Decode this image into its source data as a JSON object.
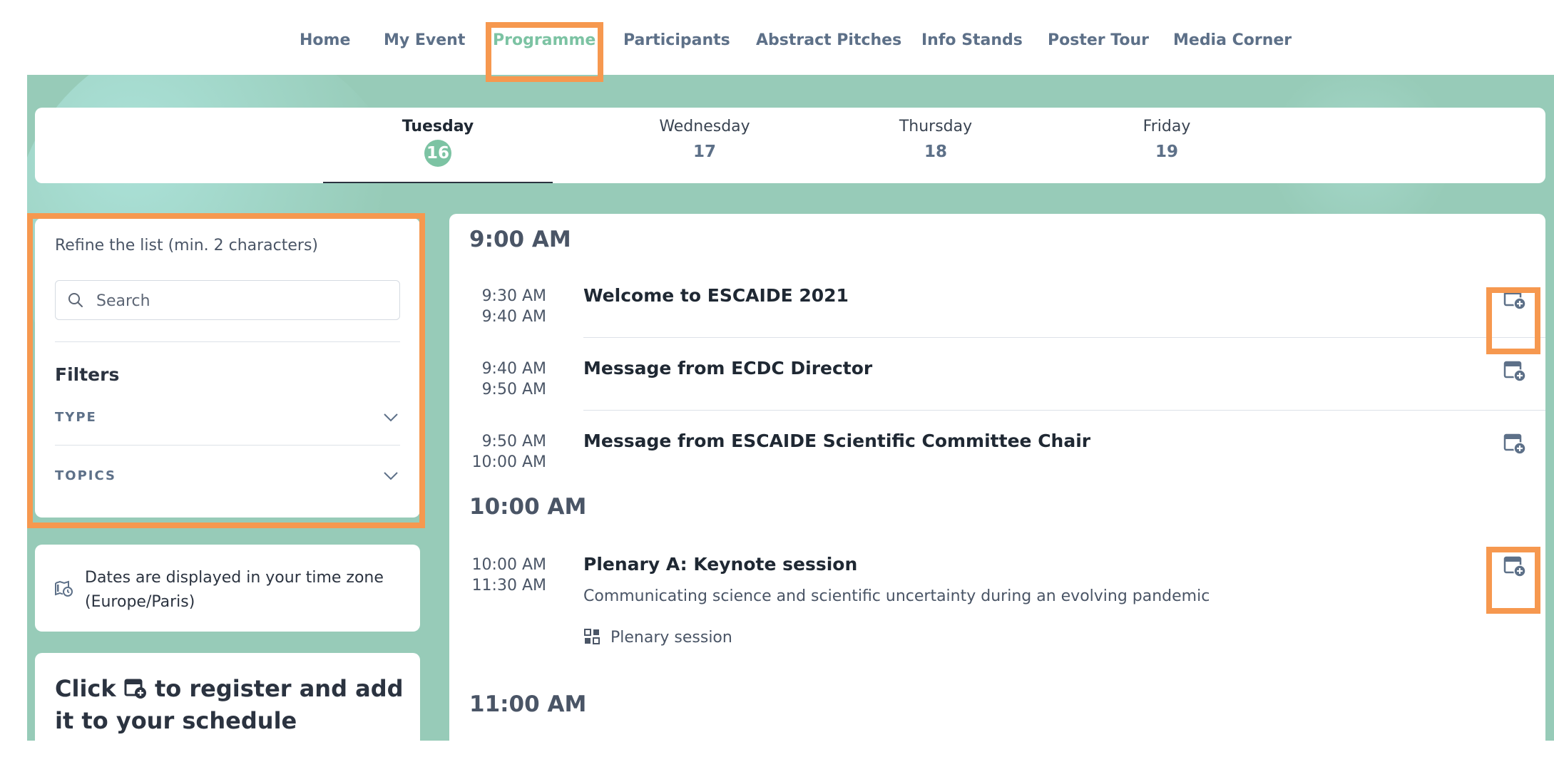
{
  "nav": {
    "items": [
      {
        "label": "Home"
      },
      {
        "label": "My Event"
      },
      {
        "label": "Programme",
        "active": true
      },
      {
        "label": "Participants"
      },
      {
        "label": "Abstract Pitches"
      },
      {
        "label": "Info Stands"
      },
      {
        "label": "Poster Tour"
      },
      {
        "label": "Media Corner"
      }
    ]
  },
  "days": [
    {
      "name": "Tuesday",
      "num": "16",
      "active": true
    },
    {
      "name": "Wednesday",
      "num": "17"
    },
    {
      "name": "Thursday",
      "num": "18"
    },
    {
      "name": "Friday",
      "num": "19"
    }
  ],
  "refine": {
    "label": "Refine the list (min. 2 characters)",
    "search_placeholder": "Search",
    "search_value": "",
    "filters_title": "Filters",
    "filters": [
      {
        "label": "TYPE"
      },
      {
        "label": "TOPICS"
      }
    ]
  },
  "timezone_note": "Dates are displayed in your time zone (Europe/Paris)",
  "tip": {
    "before": "Click",
    "after": "to register and add it to your schedule",
    "icon": "calendar-add-icon"
  },
  "schedule": {
    "hours": [
      {
        "label": "9:00 AM"
      },
      {
        "label": "10:00 AM"
      },
      {
        "label": "11:00 AM"
      }
    ],
    "sessions": [
      {
        "start": "9:30 AM",
        "end": "9:40 AM",
        "title": "Welcome to ESCAIDE 2021"
      },
      {
        "start": "9:40 AM",
        "end": "9:50 AM",
        "title": "Message from ECDC Director"
      },
      {
        "start": "9:50 AM",
        "end": "10:00 AM",
        "title": "Message from ESCAIDE Scientific Committee Chair"
      },
      {
        "start": "10:00 AM",
        "end": "11:30 AM",
        "title": "Plenary A: Keynote session",
        "subtitle": "Communicating science and scientific uncertainty during an evolving pandemic",
        "tag": "Plenary session",
        "tag_icon": "grid-icon"
      }
    ],
    "add_icon": "calendar-add-icon"
  },
  "colors": {
    "accent": "#7cc3a3",
    "backdrop": "#97cbb8",
    "highlight": "#f6984f",
    "nav_text": "#5d7088"
  }
}
